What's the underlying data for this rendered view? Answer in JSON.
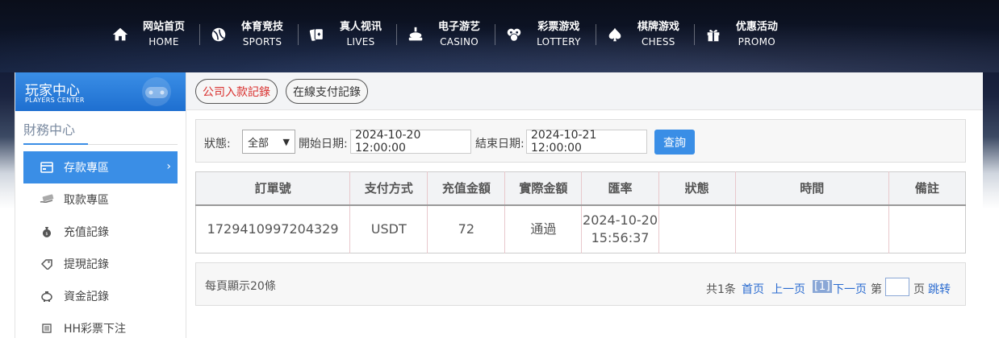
{
  "nav": [
    {
      "zh": "网站首页",
      "en": "HOME",
      "icon": "home-icon"
    },
    {
      "zh": "体育竞技",
      "en": "SPORTS",
      "icon": "ball-icon"
    },
    {
      "zh": "真人视讯",
      "en": "LIVES",
      "icon": "cards-icon"
    },
    {
      "zh": "电子游艺",
      "en": "CASINO",
      "icon": "slot-icon"
    },
    {
      "zh": "彩票游戏",
      "en": "LOTTERY",
      "icon": "lottery-balls-icon"
    },
    {
      "zh": "棋牌游戏",
      "en": "CHESS",
      "icon": "spade-icon"
    },
    {
      "zh": "优惠活动",
      "en": "PROMO",
      "icon": "gift-icon"
    }
  ],
  "sidebar": {
    "title": "玩家中心",
    "subtitle": "PLAYERS CENTER",
    "section": "財務中心",
    "items": [
      {
        "label": "存款專區",
        "icon": "wallet-icon",
        "active": true
      },
      {
        "label": "取款專區",
        "icon": "cash-icon"
      },
      {
        "label": "充值記錄",
        "icon": "money-bag-icon"
      },
      {
        "label": "提現記錄",
        "icon": "tag-icon"
      },
      {
        "label": "資金記錄",
        "icon": "piggy-bank-icon"
      },
      {
        "label": "HH彩票下注",
        "icon": "list-icon"
      }
    ]
  },
  "tabs": {
    "company_deposit": "公司入款記錄",
    "online_payment": "在線支付記錄"
  },
  "filter": {
    "status_label": "狀態:",
    "status_value": "全部",
    "start_label": "開始日期:",
    "start_value": "2024-10-20 12:00:00",
    "end_label": "結束日期:",
    "end_value": "2024-10-21 12:00:00",
    "query": "查詢"
  },
  "table": {
    "headers": [
      "訂單號",
      "支付方式",
      "充值金額",
      "實際金額",
      "匯率",
      "狀態",
      "時間",
      "備註"
    ],
    "rows": [
      [
        "1729410997204329",
        "USDT",
        "72",
        "通過",
        "2024-10-20 15:56:37",
        "",
        "",
        ""
      ]
    ]
  },
  "pager": {
    "per_page": "每頁顯示20條",
    "total": "共1条",
    "first": "首页",
    "prev": "上一页",
    "current": "[1]",
    "next": "下一页",
    "page_prefix": "第",
    "page_suffix": "页",
    "jump": "跳转"
  },
  "colors": {
    "accent": "#3a8ee6",
    "tab_active_text": "#d9302e",
    "link": "#2a6bd0"
  }
}
